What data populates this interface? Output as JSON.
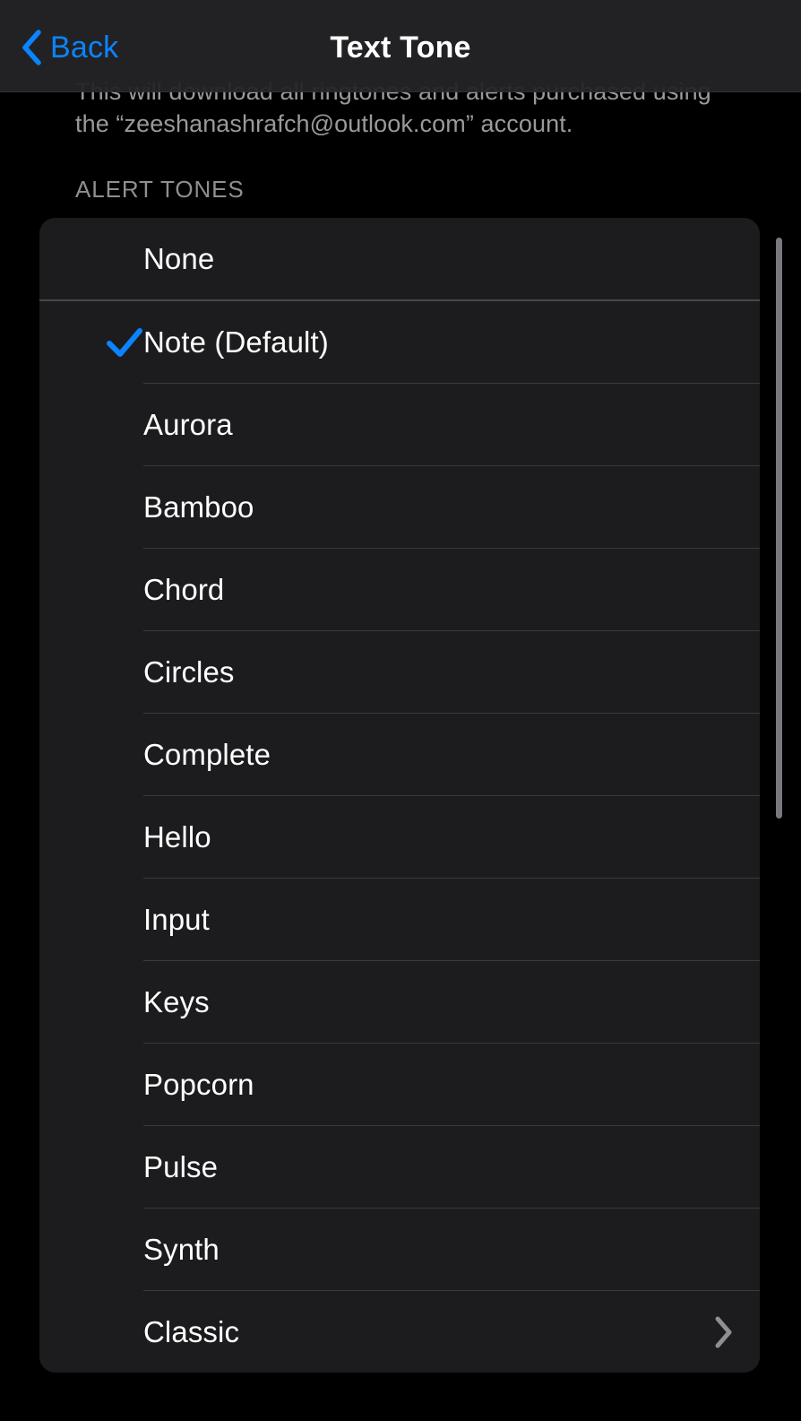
{
  "navbar": {
    "back_label": "Back",
    "title": "Text Tone",
    "back_icon": "chevron-left-icon",
    "accent_color": "#0a84ff",
    "background_color": "#242426"
  },
  "content": {
    "footer_note": "This will download all ringtones and alerts purchased using the “zeeshanashrafch@outlook.com” account.",
    "section_header": "ALERT TONES"
  },
  "list": {
    "card_background": "#1c1c1e",
    "separator_color": "#3a3a3c",
    "rows": [
      {
        "label": "None",
        "selected": false,
        "disclosure": false
      },
      {
        "label": "Note (Default)",
        "selected": true,
        "disclosure": false
      },
      {
        "label": "Aurora",
        "selected": false,
        "disclosure": false
      },
      {
        "label": "Bamboo",
        "selected": false,
        "disclosure": false
      },
      {
        "label": "Chord",
        "selected": false,
        "disclosure": false
      },
      {
        "label": "Circles",
        "selected": false,
        "disclosure": false
      },
      {
        "label": "Complete",
        "selected": false,
        "disclosure": false
      },
      {
        "label": "Hello",
        "selected": false,
        "disclosure": false
      },
      {
        "label": "Input",
        "selected": false,
        "disclosure": false
      },
      {
        "label": "Keys",
        "selected": false,
        "disclosure": false
      },
      {
        "label": "Popcorn",
        "selected": false,
        "disclosure": false
      },
      {
        "label": "Pulse",
        "selected": false,
        "disclosure": false
      },
      {
        "label": "Synth",
        "selected": false,
        "disclosure": false
      },
      {
        "label": "Classic",
        "selected": false,
        "disclosure": true
      }
    ],
    "checkmark_icon": "checkmark-icon",
    "checkmark_color": "#0a84ff",
    "disclosure_icon": "chevron-right-icon",
    "disclosure_color": "#8e8e93"
  },
  "scrollbar": {
    "visible": true,
    "color": "#8e8e93"
  }
}
